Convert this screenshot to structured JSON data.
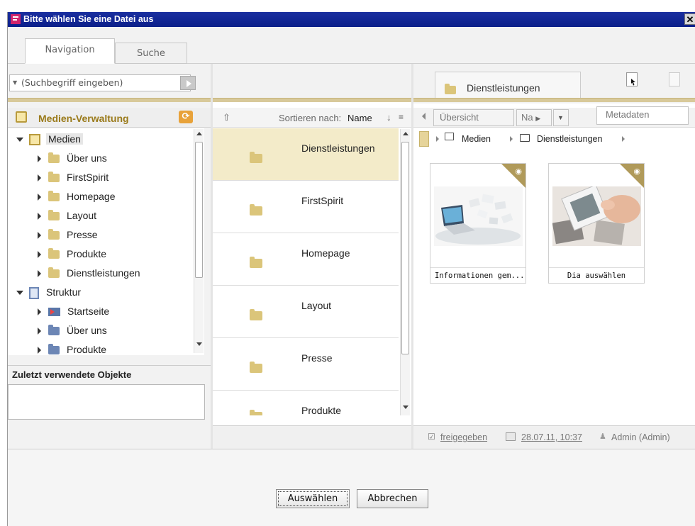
{
  "window": {
    "title": "Bitte wählen Sie eine Datei aus",
    "close_glyph": "✕"
  },
  "tabs": [
    {
      "label": "Navigation",
      "active": true
    },
    {
      "label": "Suche",
      "active": false
    }
  ],
  "search": {
    "placeholder": "(Suchbegriff eingeben)"
  },
  "left_panel": {
    "title": "Medien-Verwaltung",
    "tree": [
      {
        "label": "Medien",
        "level": 0,
        "expanded": true,
        "icon": "media-root-icon"
      },
      {
        "label": "Über uns",
        "level": 1,
        "icon": "folder-icon"
      },
      {
        "label": "FirstSpirit",
        "level": 1,
        "icon": "folder-icon"
      },
      {
        "label": "Homepage",
        "level": 1,
        "icon": "folder-icon"
      },
      {
        "label": "Layout",
        "level": 1,
        "icon": "folder-icon"
      },
      {
        "label": "Presse",
        "level": 1,
        "icon": "folder-icon"
      },
      {
        "label": "Produkte",
        "level": 1,
        "icon": "folder-icon"
      },
      {
        "label": "Dienstleistungen",
        "level": 1,
        "icon": "folder-icon"
      },
      {
        "label": "Struktur",
        "level": 0,
        "expanded": true,
        "icon": "structure-root-icon"
      },
      {
        "label": "Startseite",
        "level": 1,
        "icon": "start-page-icon"
      },
      {
        "label": "Über uns",
        "level": 1,
        "icon": "blue-folder-icon"
      },
      {
        "label": "Produkte",
        "level": 1,
        "icon": "blue-folder-icon"
      }
    ],
    "recent_title": "Zuletzt verwendete Objekte"
  },
  "middle_panel": {
    "sort_label": "Sortieren nach:",
    "sort_value": "Name",
    "sort_direction_glyph": "↓",
    "menu_glyph": "≡",
    "up_glyph": "⇧",
    "rows": [
      {
        "label": "Dienstleistungen",
        "selected": true
      },
      {
        "label": "FirstSpirit",
        "selected": false
      },
      {
        "label": "Homepage",
        "selected": false
      },
      {
        "label": "Layout",
        "selected": false
      },
      {
        "label": "Presse",
        "selected": false
      },
      {
        "label": "Produkte",
        "selected": false
      }
    ]
  },
  "right_panel": {
    "folder_tab": "Dienstleistungen",
    "view_overview": "Übersicht",
    "view_name_short": "Na",
    "metadata": "Metadaten",
    "breadcrumb": [
      "Medien",
      "Dienstleistungen"
    ],
    "thumbnails": [
      {
        "caption": "Informationen gem...",
        "icon": "eye-icon"
      },
      {
        "caption": "Dia auswählen",
        "icon": "eye-icon"
      }
    ],
    "status": {
      "state": "freigegeben",
      "date": "28.07.11, 10:37",
      "user": "Admin (Admin)"
    }
  },
  "footer": {
    "select_label": "Auswählen",
    "cancel_label": "Abbrechen"
  },
  "colors": {
    "titlebar": "#0b1f8a",
    "accent_gold": "#9a7a1a",
    "selection": "#f3ebc9"
  }
}
